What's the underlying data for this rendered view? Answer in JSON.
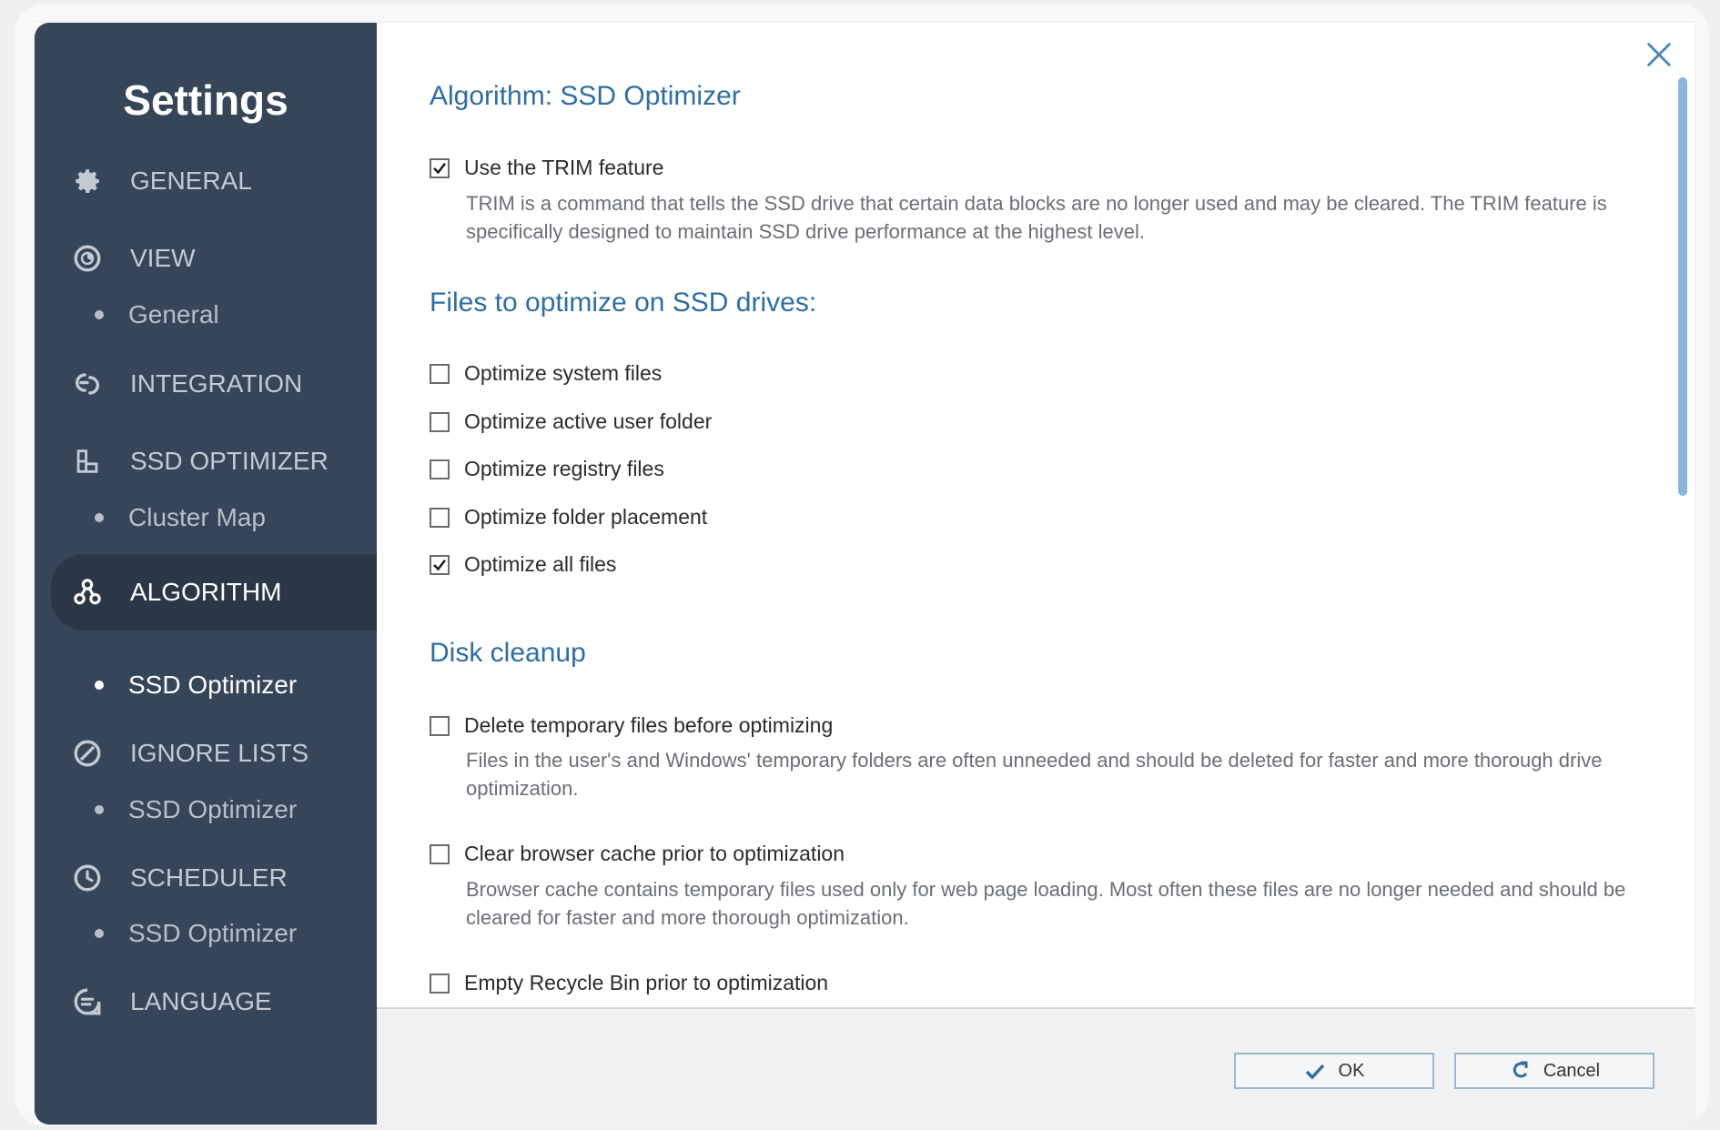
{
  "sidebar": {
    "title": "Settings",
    "items": [
      {
        "label": "GENERAL",
        "icon": "gear-icon"
      },
      {
        "label": "VIEW",
        "icon": "eye-icon"
      },
      {
        "label": "General"
      },
      {
        "label": "INTEGRATION",
        "icon": "integration-icon"
      },
      {
        "label": "SSD OPTIMIZER",
        "icon": "ssd-icon"
      },
      {
        "label": "Cluster Map"
      },
      {
        "label": "ALGORITHM",
        "icon": "algorithm-icon"
      },
      {
        "label": "SSD Optimizer"
      },
      {
        "label": "IGNORE LISTS",
        "icon": "ignore-icon"
      },
      {
        "label": "SSD Optimizer"
      },
      {
        "label": "SCHEDULER",
        "icon": "clock-icon"
      },
      {
        "label": "SSD Optimizer"
      },
      {
        "label": "LANGUAGE",
        "icon": "language-icon"
      }
    ]
  },
  "main": {
    "algorithm_heading": "Algorithm: SSD Optimizer",
    "trim": {
      "label": "Use the TRIM feature",
      "checked": true,
      "description": "TRIM is a command that tells the SSD drive that certain data blocks are no longer used and may be cleared. The TRIM feature is specifically designed to maintain SSD drive performance at the highest level."
    },
    "files_heading": "Files to optimize on SSD drives:",
    "files_options": [
      {
        "label": "Optimize system files",
        "checked": false
      },
      {
        "label": "Optimize active user folder",
        "checked": false
      },
      {
        "label": "Optimize registry files",
        "checked": false
      },
      {
        "label": "Optimize folder placement",
        "checked": false
      },
      {
        "label": "Optimize all files",
        "checked": true
      }
    ],
    "cleanup_heading": "Disk cleanup",
    "cleanup_options": [
      {
        "label": "Delete temporary files before optimizing",
        "checked": false,
        "description": "Files in the user's and Windows' temporary folders are often unneeded and should be deleted for faster and more thorough drive optimization."
      },
      {
        "label": "Clear browser cache prior to optimization",
        "checked": false,
        "description": "Browser cache contains temporary files used only for web page loading. Most often these files are no longer needed and should be cleared for faster and more thorough optimization."
      },
      {
        "label": "Empty Recycle Bin prior to optimization",
        "checked": false
      }
    ]
  },
  "footer": {
    "ok_label": "OK",
    "cancel_label": "Cancel"
  },
  "colors": {
    "sidebar_bg": "#364558",
    "sidebar_active": "#2b3747",
    "heading": "#2f6ea1",
    "scrollbar": "#8bb5d9"
  }
}
